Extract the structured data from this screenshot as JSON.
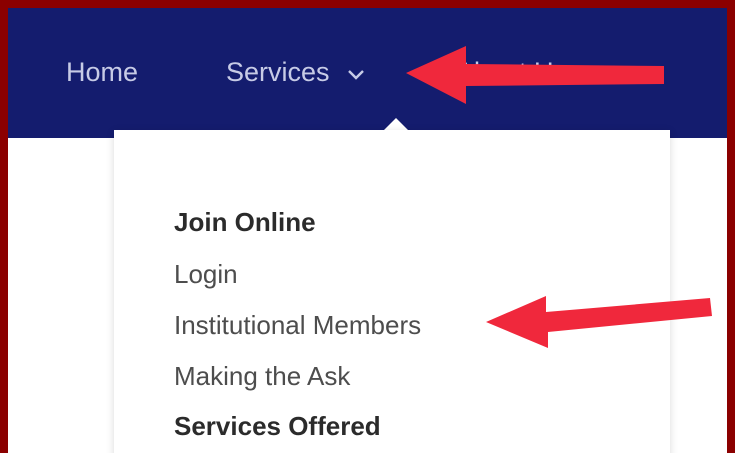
{
  "nav": {
    "items": [
      {
        "label": "Home"
      },
      {
        "label": "Services"
      },
      {
        "label": "About Us"
      }
    ],
    "background": "#141c6e",
    "text_color": "#c7cbe6"
  },
  "dropdown": {
    "items": [
      {
        "label": "Join Online",
        "bold": true
      },
      {
        "label": "Login",
        "bold": false
      },
      {
        "label": "Institutional Members",
        "bold": false
      },
      {
        "label": "Making the Ask",
        "bold": false
      },
      {
        "label": "Services Offered",
        "bold": true
      }
    ]
  },
  "annotations": {
    "arrow_color": "#f0283c",
    "border_color": "#8b0000"
  }
}
